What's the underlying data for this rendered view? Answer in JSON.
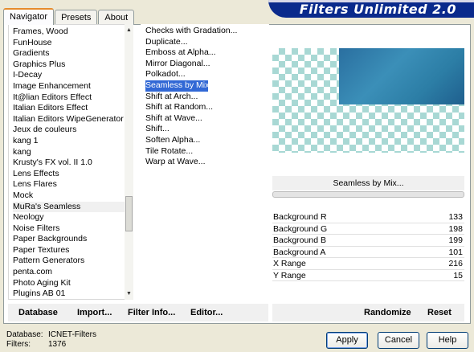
{
  "tabs": [
    "Navigator",
    "Presets",
    "About"
  ],
  "title": "Filters Unlimited 2.0",
  "categories": [
    "Frames, Wood",
    "FunHouse",
    "Gradients",
    "Graphics Plus",
    "I-Decay",
    "Image Enhancement",
    "It@lian Editors Effect",
    "Italian Editors Effect",
    "Italian Editors WipeGenerator",
    "Jeux de couleurs",
    "kang 1",
    "kang",
    "Krusty's FX vol. II 1.0",
    "Lens Effects",
    "Lens Flares",
    "Mock",
    "MuRa's Seamless",
    "Neology",
    "Noise Filters",
    "Paper Backgrounds",
    "Paper Textures",
    "Pattern Generators",
    "penta.com",
    "Photo Aging Kit",
    "Plugins AB 01"
  ],
  "filters": [
    "Checks with Gradation...",
    "Duplicate...",
    "Emboss at Alpha...",
    "Mirror Diagonal...",
    "Polkadot...",
    "Seamless by Mix...",
    "Shift at Arch...",
    "Shift at Random...",
    "Shift at Wave...",
    "Shift...",
    "Soften Alpha...",
    "Tile Rotate...",
    "Warp at Wave..."
  ],
  "selected_filter": "Seamless by Mix...",
  "params": [
    {
      "label": "Background R",
      "value": "133"
    },
    {
      "label": "Background G",
      "value": "198"
    },
    {
      "label": "Background B",
      "value": "199"
    },
    {
      "label": "Background A",
      "value": "101"
    },
    {
      "label": "X Range",
      "value": "216"
    },
    {
      "label": "Y Range",
      "value": "15"
    }
  ],
  "bottom_left": {
    "database": "Database",
    "import": "Import...",
    "filter_info": "Filter Info...",
    "editor": "Editor..."
  },
  "bottom_right": {
    "randomize": "Randomize",
    "reset": "Reset"
  },
  "status": {
    "db_label": "Database:",
    "db_value": "ICNET-Filters",
    "filters_label": "Filters:",
    "filters_value": "1376"
  },
  "buttons": {
    "apply": "Apply",
    "cancel": "Cancel",
    "help": "Help"
  }
}
